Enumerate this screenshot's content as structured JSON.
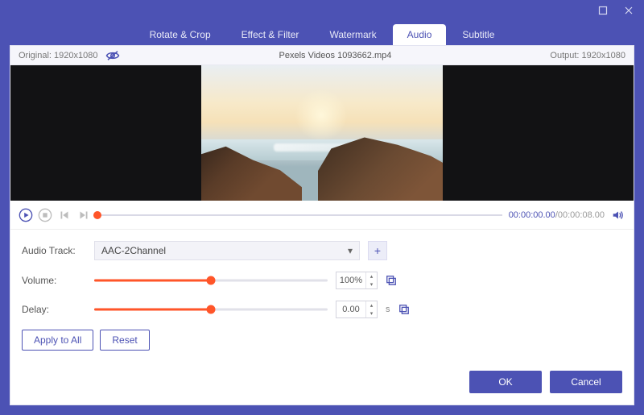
{
  "window": {
    "title_hidden": true
  },
  "tabs": {
    "items": [
      {
        "label": "Rotate & Crop"
      },
      {
        "label": "Effect & Filter"
      },
      {
        "label": "Watermark"
      },
      {
        "label": "Audio"
      },
      {
        "label": "Subtitle"
      }
    ],
    "active_index": 3
  },
  "infobar": {
    "original_label": "Original: 1920x1080",
    "filename": "Pexels Videos 1093662.mp4",
    "output_label": "Output: 1920x1080"
  },
  "playback": {
    "current_time": "00:00:00.00",
    "total_time": "00:00:08.00",
    "position_pct": 0
  },
  "audio": {
    "track_label": "Audio Track:",
    "track_value": "AAC-2Channel",
    "volume_label": "Volume:",
    "volume_value": "100%",
    "volume_pct": 50,
    "delay_label": "Delay:",
    "delay_value": "0.00",
    "delay_pct": 50,
    "delay_unit": "s"
  },
  "buttons": {
    "apply_all": "Apply to All",
    "reset": "Reset",
    "ok": "OK",
    "cancel": "Cancel"
  }
}
